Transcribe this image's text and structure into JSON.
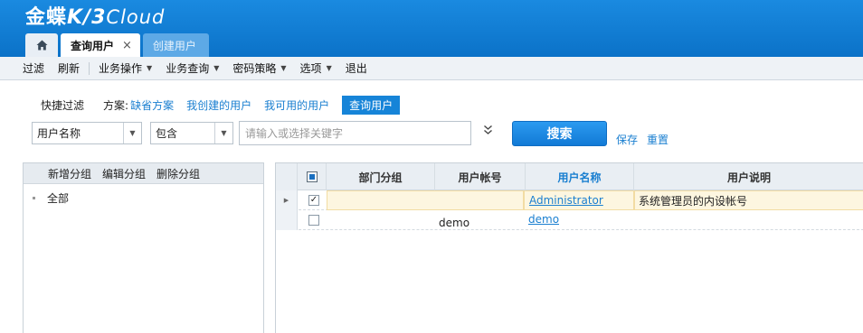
{
  "app": {
    "logo_main": "金蝶",
    "logo_k3": "K/3",
    "logo_cloud": "Cloud"
  },
  "tabs": [
    {
      "label": "查询用户",
      "active": true,
      "close": "×"
    },
    {
      "label": "创建用户",
      "active": false
    }
  ],
  "menubar": {
    "items": [
      {
        "label": "过滤"
      },
      {
        "label": "刷新"
      },
      {
        "label": "业务操作",
        "dropdown": true
      },
      {
        "label": "业务查询",
        "dropdown": true
      },
      {
        "label": "密码策略",
        "dropdown": true
      },
      {
        "label": "选项",
        "dropdown": true
      },
      {
        "label": "退出"
      }
    ]
  },
  "filter": {
    "quick_label": "快捷过滤",
    "scheme_label": "方案:",
    "schemes": [
      "缺省方案",
      "我创建的用户",
      "我可用的用户"
    ],
    "current_scheme": "查询用户"
  },
  "search": {
    "field_value": "用户名称",
    "operator_value": "包含",
    "keyword_placeholder": "请输入或选择关键字",
    "expand_icon": "»",
    "search_label": "搜索",
    "save_label": "保存",
    "reset_label": "重置"
  },
  "left_panel": {
    "toolbar": [
      "新增分组",
      "编辑分组",
      "删除分组"
    ],
    "tree": [
      {
        "label": "全部"
      }
    ]
  },
  "grid": {
    "columns": [
      "部门分组",
      "用户帐号",
      "用户名称",
      "用户说明"
    ],
    "sorted_column": "用户名称",
    "rows": [
      {
        "checked": true,
        "dept": "",
        "account": "",
        "name": "Administrator",
        "description": "系统管理员的内设帐号"
      },
      {
        "checked": false,
        "dept": "",
        "account": "demo",
        "name": "demo",
        "description": ""
      }
    ]
  },
  "colors": {
    "header_blue": "#0b72c8",
    "link_blue": "#1a7fd0",
    "selected_row": "#fdf6e0"
  }
}
